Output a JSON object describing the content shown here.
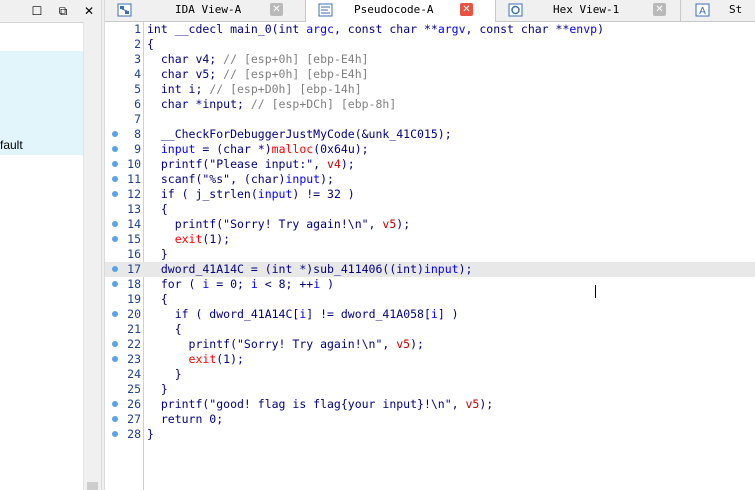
{
  "left_panel": {
    "visible_text": "fault"
  },
  "tabs": [
    {
      "label": "IDA View-A",
      "icon": "graph-icon",
      "active": false
    },
    {
      "label": "Pseudocode-A",
      "icon": "pseudocode-icon",
      "active": true
    },
    {
      "label": "Hex View-1",
      "icon": "hex-icon",
      "active": false
    },
    {
      "label": "St",
      "icon": "structures-icon",
      "active": false
    }
  ],
  "code": {
    "current_line": 17,
    "lines": [
      {
        "n": "1",
        "bp": false,
        "t": "int __cdecl main_0(int argc, const char **argv, const char **envp)"
      },
      {
        "n": "2",
        "bp": false,
        "t": "{"
      },
      {
        "n": "3",
        "bp": false,
        "t": "  char v4; // [esp+0h] [ebp-E4h]"
      },
      {
        "n": "4",
        "bp": false,
        "t": "  char v5; // [esp+0h] [ebp-E4h]"
      },
      {
        "n": "5",
        "bp": false,
        "t": "  int i; // [esp+D0h] [ebp-14h]"
      },
      {
        "n": "6",
        "bp": false,
        "t": "  char *input; // [esp+DCh] [ebp-8h]"
      },
      {
        "n": "7",
        "bp": false,
        "t": ""
      },
      {
        "n": "8",
        "bp": true,
        "t": "  __CheckForDebuggerJustMyCode(&unk_41C015);"
      },
      {
        "n": "9",
        "bp": true,
        "t": "  input = (char *)malloc(0x64u);"
      },
      {
        "n": "10",
        "bp": true,
        "t": "  printf(\"Please input:\", v4);"
      },
      {
        "n": "11",
        "bp": true,
        "t": "  scanf(\"%s\", (char)input);"
      },
      {
        "n": "12",
        "bp": true,
        "t": "  if ( j_strlen(input) != 32 )"
      },
      {
        "n": "13",
        "bp": false,
        "t": "  {"
      },
      {
        "n": "14",
        "bp": true,
        "t": "    printf(\"Sorry! Try again!\\n\", v5);"
      },
      {
        "n": "15",
        "bp": true,
        "t": "    exit(1);"
      },
      {
        "n": "16",
        "bp": false,
        "t": "  }"
      },
      {
        "n": "17",
        "bp": true,
        "t": "  dword_41A14C = (int *)sub_411406((int)input);"
      },
      {
        "n": "18",
        "bp": true,
        "t": "  for ( i = 0; i < 8; ++i )"
      },
      {
        "n": "19",
        "bp": false,
        "t": "  {"
      },
      {
        "n": "20",
        "bp": true,
        "t": "    if ( dword_41A14C[i] != dword_41A058[i] )"
      },
      {
        "n": "21",
        "bp": false,
        "t": "    {"
      },
      {
        "n": "22",
        "bp": true,
        "t": "      printf(\"Sorry! Try again!\\n\", v5);"
      },
      {
        "n": "23",
        "bp": true,
        "t": "      exit(1);"
      },
      {
        "n": "24",
        "bp": false,
        "t": "    }"
      },
      {
        "n": "25",
        "bp": false,
        "t": "  }"
      },
      {
        "n": "26",
        "bp": true,
        "t": "  printf(\"good! flag is flag{your input}!\\n\", v5);"
      },
      {
        "n": "27",
        "bp": true,
        "t": "  return 0;"
      },
      {
        "n": "28",
        "bp": true,
        "t": "}"
      }
    ]
  },
  "colors": {
    "keyword_text": "#000080",
    "comment": "#808080",
    "variable": "#0000ff",
    "function": "#ff0000",
    "current_line_bg": "#e8e8e8",
    "breakpoint_dot": "#5aa3e8",
    "active_tab_close": "#e8523f"
  }
}
